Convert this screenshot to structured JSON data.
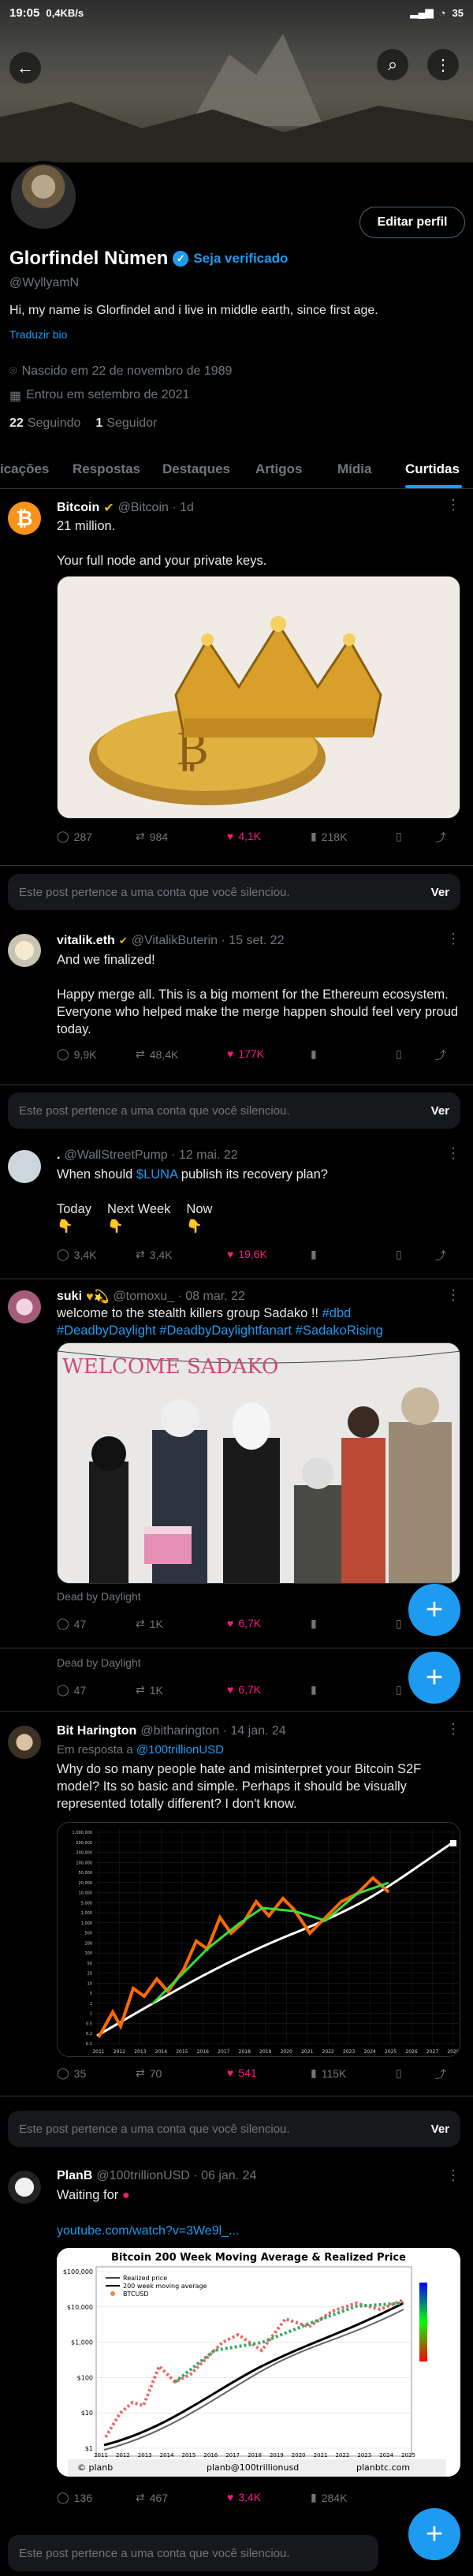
{
  "status_bar": {
    "time": "19:05",
    "speed": "0,4KB/s",
    "battery": "35"
  },
  "profile": {
    "name": "Glorfindel Nùmen",
    "verify_cta": "Seja verificado",
    "handle": "@WyllyamN",
    "bio": "Hi, my name is Glorfindel and i live in middle earth, since first age.",
    "translate": "Traduzir bio",
    "born": "Nascido em 22 de novembro de 1989",
    "joined": "Entrou em setembro de 2021",
    "following_count": "22",
    "following_label": "Seguindo",
    "followers_count": "1",
    "followers_label": "Seguidor",
    "edit_button": "Editar perfil"
  },
  "tabs": [
    "icações",
    "Respostas",
    "Destaques",
    "Artigos",
    "Mídia",
    "Curtidas"
  ],
  "active_tab": "Curtidas",
  "muted_notice": {
    "text": "Este post pertence a uma conta que você silenciou.",
    "action": "Ver"
  },
  "posts": [
    {
      "name": "Bitcoin",
      "handle": "@Bitcoin · 1d",
      "text": "21 million.\n\nYour full node and your private keys.",
      "replies": "287",
      "reposts": "984",
      "likes": "4,1K",
      "views": "218K"
    },
    {
      "name": "vitalik.eth",
      "handle": "@VitalikButerin · 15 set. 22",
      "text": "And we finalized!\n\nHappy merge all. This is a big moment for the Ethereum ecosystem. Everyone who helped make the merge happen should feel very proud today.",
      "replies": "9,9K",
      "reposts": "48,4K",
      "likes": "177K"
    },
    {
      "name": ".",
      "handle": "@WallStreetPump · 12 mai. 22",
      "text_before": "When should ",
      "cashtag": "$LUNA",
      "text_after": " publish its recovery plan?",
      "options": [
        "Today",
        "Next Week",
        "Now"
      ],
      "replies": "3,4K",
      "reposts": "3,4K",
      "likes": "19,6K"
    },
    {
      "name": "suki",
      "handle": "@tomoxu_ · 08 mar. 22",
      "text": "welcome to the stealth killers group Sadako !! ",
      "hashtags": [
        "#dbd",
        "#DeadbyDaylight",
        "#DeadbyDaylightfanart",
        "#SadakoRising"
      ],
      "banner": "WELCOME   SADAKO",
      "caption": "Dead by Daylight",
      "replies": "47",
      "reposts": "1K",
      "likes": "6,7K"
    },
    {
      "caption": "Dead by Daylight",
      "replies": "47",
      "reposts": "1K",
      "likes": "6,7K"
    },
    {
      "name": "Bit Harington",
      "handle": "@bitharington · 14 jan. 24",
      "reply_prefix": "Em resposta a ",
      "reply_to": "@100trillionUSD",
      "text": "Why do so many people hate and misinterpret your Bitcoin S2F model? Its so basic and simple. Perhaps it should be visually represented totally different? I don't know.",
      "replies": "35",
      "reposts": "70",
      "likes": "541",
      "views": "115K",
      "chart_y_ticks": [
        "1,000,000",
        "500,000",
        "200,000",
        "100,000",
        "50,000",
        "20,000",
        "10,000",
        "5,000",
        "2,000",
        "1,000",
        "500",
        "200",
        "100",
        "50",
        "20",
        "10",
        "5",
        "2",
        "1",
        "0.5",
        "0.2",
        "0.1"
      ],
      "chart_x_ticks": [
        "2011",
        "2012",
        "2013",
        "2014",
        "2015",
        "2016",
        "2017",
        "2018",
        "2019",
        "2020",
        "2021",
        "2022",
        "2023",
        "2024",
        "2025",
        "2026",
        "2027",
        "2028"
      ]
    },
    {
      "name": "PlanB",
      "handle": "@100trillionUSD · 06 jan. 24",
      "text": "Waiting for",
      "url": "youtube.com/watch?v=3We9l_...",
      "chart_title": "Bitcoin 200 Week Moving Average & Realized Price",
      "chart_legend": [
        "Realized price",
        "200 week moving average",
        "BTCUSD"
      ],
      "chart_footer": [
        "© planb",
        "planb@100trillionusd",
        "planbtc.com"
      ],
      "chart_y_ticks": [
        "$100,000",
        "$10,000",
        "$1,000",
        "$100",
        "$10",
        "$1"
      ],
      "chart_x_ticks": [
        "2011",
        "2012",
        "2013",
        "2014",
        "2015",
        "2016",
        "2017",
        "2018",
        "2019",
        "2020",
        "2021",
        "2022",
        "2023",
        "2024",
        "2025"
      ],
      "replies": "136",
      "reposts": "467",
      "likes": "3,4K",
      "views": "284K"
    }
  ],
  "colors": {
    "accent": "#1d9bf0",
    "like": "#f91880",
    "bg": "#000000"
  }
}
